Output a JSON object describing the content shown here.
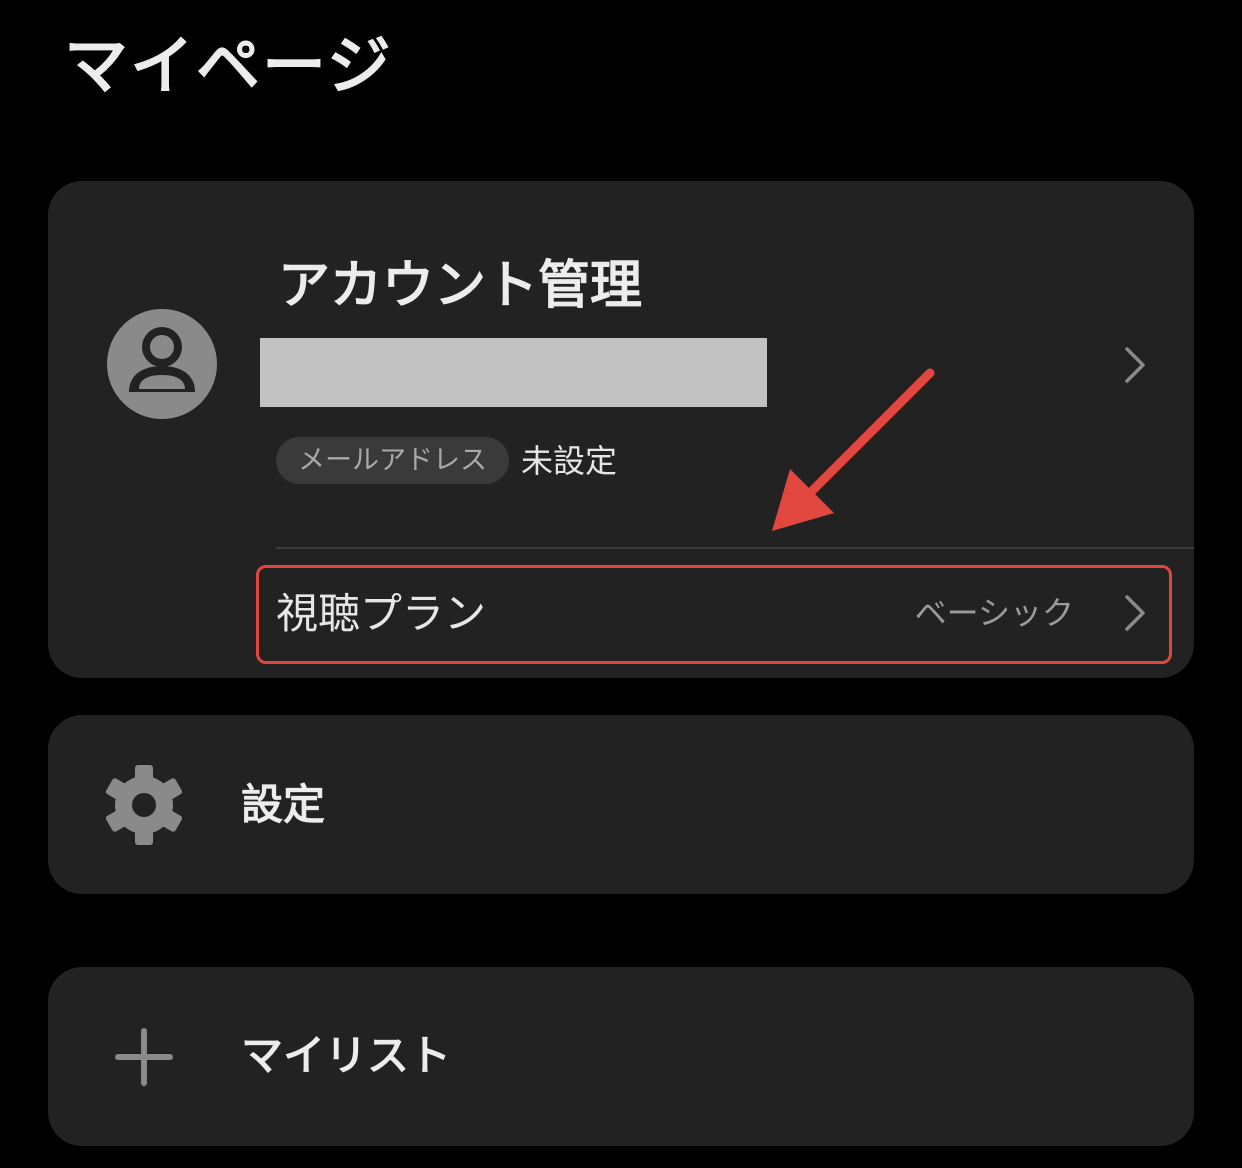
{
  "page": {
    "title": "マイページ"
  },
  "account_card": {
    "title": "アカウント管理",
    "email_badge": "メールアドレス",
    "email_value": "未設定",
    "plan_label": "視聴プラン",
    "plan_value": "ベーシック"
  },
  "settings_card": {
    "label": "設定"
  },
  "mylist_card": {
    "label": "マイリスト"
  },
  "icons": {
    "avatar": "user-avatar-icon",
    "account_chevron": "chevron-right-icon",
    "plan_chevron": "chevron-right-icon",
    "settings": "gear-icon",
    "mylist": "plus-icon",
    "annotation": "arrow-annotation-icon"
  },
  "colors": {
    "background": "#000000",
    "card": "#222222",
    "highlight": "#e2473f",
    "icon_gray": "#8a8a8a",
    "redaction": "#c2c2c2"
  }
}
